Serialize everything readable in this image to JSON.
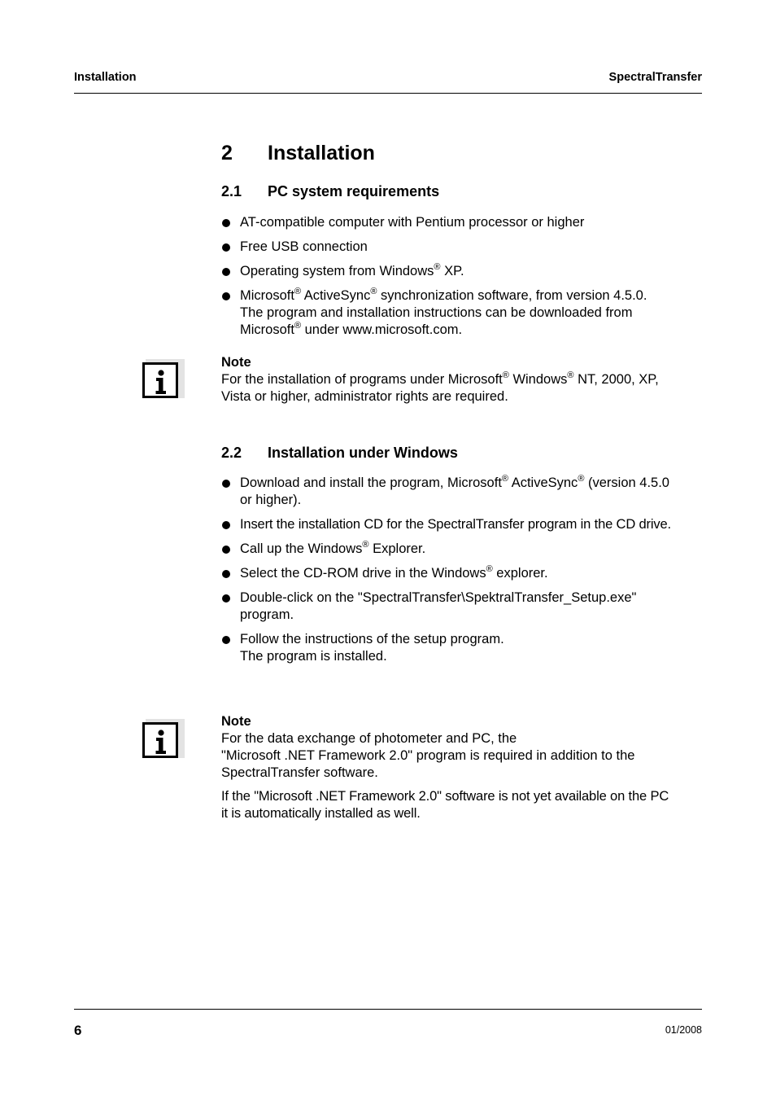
{
  "header": {
    "left": "Installation",
    "right": "SpectralTransfer"
  },
  "footer": {
    "page_number": "6",
    "date": "01/2008"
  },
  "chapter": {
    "number": "2",
    "title": "Installation"
  },
  "section_2_1": {
    "number": "2.1",
    "title": "PC system requirements",
    "items": [
      {
        "parts": [
          "AT-compatible computer with Pentium processor or higher"
        ]
      },
      {
        "parts": [
          "Free USB connection"
        ]
      },
      {
        "parts": [
          "Operating system from Windows",
          "®",
          " XP."
        ]
      },
      {
        "parts": [
          "Microsoft",
          "®",
          " ActiveSync",
          "®",
          " synchronization software, from version 4.5.0.",
          "The program and installation instructions can be downloaded from",
          "Microsoft",
          "®",
          " under www.microsoft.com."
        ]
      }
    ]
  },
  "note_1": {
    "title": "Note",
    "text_parts": [
      "For the installation of programs under Microsoft",
      "®",
      " Windows",
      "®",
      " NT, 2000, XP,",
      "Vista or higher, administrator rights are required."
    ]
  },
  "section_2_2": {
    "number": "2.2",
    "title": "Installation under Windows",
    "items": [
      {
        "parts": [
          "Download and install the program, Microsoft",
          "®",
          " ActiveSync",
          "®",
          " (version 4.5.0",
          "or higher)."
        ]
      },
      {
        "parts": [
          "Insert the installation CD for the SpectralTransfer program in the CD drive."
        ]
      },
      {
        "parts": [
          "Call up the Windows",
          "®",
          " Explorer."
        ]
      },
      {
        "parts": [
          "Select the CD-ROM drive in the Windows",
          "®",
          " explorer."
        ]
      },
      {
        "parts": [
          "Double-click on the \"SpectralTransfer\\SpektralTransfer_Setup.exe\"",
          "program."
        ]
      },
      {
        "parts": [
          "Follow the instructions of the setup program.",
          "The program is installed."
        ]
      }
    ]
  },
  "note_2": {
    "title": "Note",
    "paragraph_1_lines": [
      "For the data exchange of photometer and PC, the",
      "\"Microsoft .NET Framework 2.0\" program is required in addition to the",
      "SpectralTransfer software."
    ],
    "paragraph_2_lines": [
      "If the \"Microsoft .NET Framework 2.0\" software is not yet available on the PC",
      "it is automatically installed as well."
    ]
  },
  "icons": {
    "note_icon": "info-icon"
  }
}
